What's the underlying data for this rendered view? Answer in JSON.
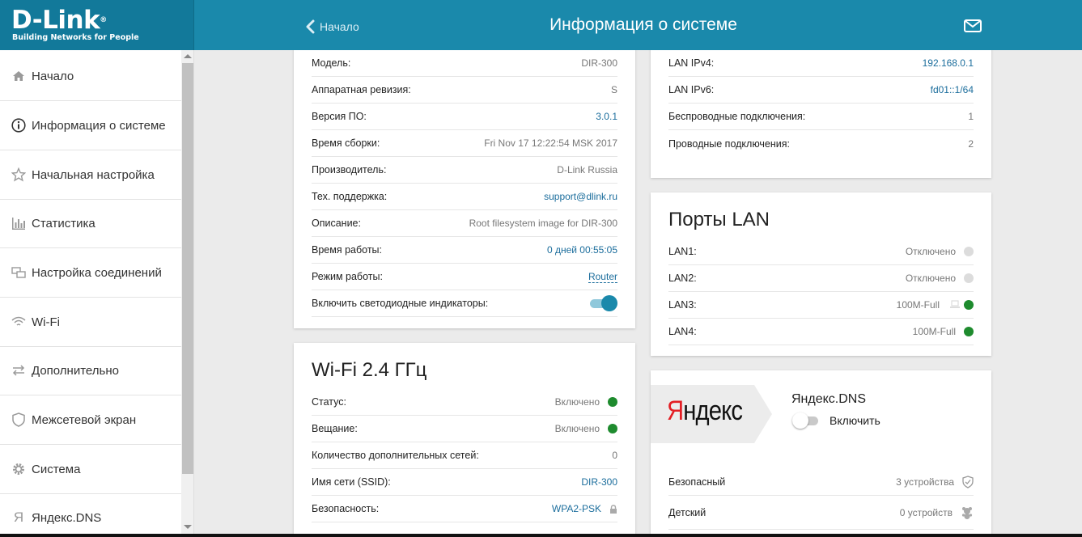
{
  "header": {
    "logo": "D-Link",
    "logo_reg": "®",
    "tagline": "Building Networks for People",
    "back_label": "Начало",
    "title": "Информация о системе",
    "icons": {
      "back": "chevron-left-icon",
      "mail": "mail-icon"
    }
  },
  "colors": {
    "header": "#1a89ab",
    "logo_bg": "#12799a",
    "link": "#1b6d9c",
    "green": "#1e8b2e",
    "toggle_on": "#1a89ab"
  },
  "sidebar": {
    "items": [
      {
        "label": "Начало",
        "icon": "home-icon"
      },
      {
        "label": "Информация о системе",
        "icon": "info-icon",
        "active": true
      },
      {
        "label": "Начальная настройка",
        "icon": "star-icon"
      },
      {
        "label": "Статистика",
        "icon": "bar-chart-icon"
      },
      {
        "label": "Настройка соединений",
        "icon": "connections-icon"
      },
      {
        "label": "Wi-Fi",
        "icon": "wifi-icon"
      },
      {
        "label": "Дополнительно",
        "icon": "arrows-icon"
      },
      {
        "label": "Межсетевой экран",
        "icon": "shield-icon"
      },
      {
        "label": "Система",
        "icon": "gear-icon"
      },
      {
        "label": "Яндекс.DNS",
        "icon": "yandex-icon"
      }
    ]
  },
  "system": {
    "rows": [
      {
        "label": "Модель:",
        "value": "DIR-300"
      },
      {
        "label": "Аппаратная ревизия:",
        "value": "S"
      },
      {
        "label": "Версия ПО:",
        "value": "3.0.1"
      },
      {
        "label": "Время сборки:",
        "value": "Fri Nov 17 12:22:54 MSK 2017"
      },
      {
        "label": "Производитель:",
        "value": "D-Link Russia"
      },
      {
        "label": "Тех. поддержка:",
        "value": "support@dlink.ru"
      },
      {
        "label": "Описание:",
        "value": "Root filesystem image for DIR-300"
      },
      {
        "label": "Время работы:",
        "value": "0 дней 00:55:05"
      },
      {
        "label": "Режим работы:",
        "value": "Router"
      },
      {
        "label": "Включить светодиодные индикаторы:",
        "on": true
      }
    ]
  },
  "wifi": {
    "title": "Wi-Fi 2.4 ГГц",
    "rows": [
      {
        "label": "Статус:",
        "value": "Включено",
        "status": "green"
      },
      {
        "label": "Вещание:",
        "value": "Включено",
        "status": "green"
      },
      {
        "label": "Количество дополнительных сетей:",
        "value": "0"
      },
      {
        "label": "Имя сети (SSID):",
        "value": "DIR-300"
      },
      {
        "label": "Безопасность:",
        "value": "WPA2-PSK",
        "icon": "lock-icon"
      }
    ]
  },
  "network": {
    "rows": [
      {
        "label": "LAN IPv4:",
        "value": "192.168.0.1"
      },
      {
        "label": "LAN IPv6:",
        "value": "fd01::1/64"
      },
      {
        "label": "Беспроводные подключения:",
        "value": "1"
      },
      {
        "label": "Проводные подключения:",
        "value": "2"
      }
    ]
  },
  "lan": {
    "title": "Порты LAN",
    "rows": [
      {
        "label": "LAN1:",
        "value": "Отключено",
        "status": "gray"
      },
      {
        "label": "LAN2:",
        "value": "Отключено",
        "status": "gray"
      },
      {
        "label": "LAN3:",
        "value": "100M-Full",
        "status": "green",
        "icon": "computer-icon"
      },
      {
        "label": "LAN4:",
        "value": "100M-Full",
        "status": "green"
      }
    ]
  },
  "yandex": {
    "logo": "Яндекс",
    "service": "Яндекс.DNS",
    "enable_label": "Включить",
    "enabled": false,
    "rows": [
      {
        "label": "Безопасный",
        "value": "3 устройства",
        "icon": "shield-check-icon"
      },
      {
        "label": "Детский",
        "value": "0 устройств",
        "icon": "teddy-bear-icon"
      }
    ]
  }
}
